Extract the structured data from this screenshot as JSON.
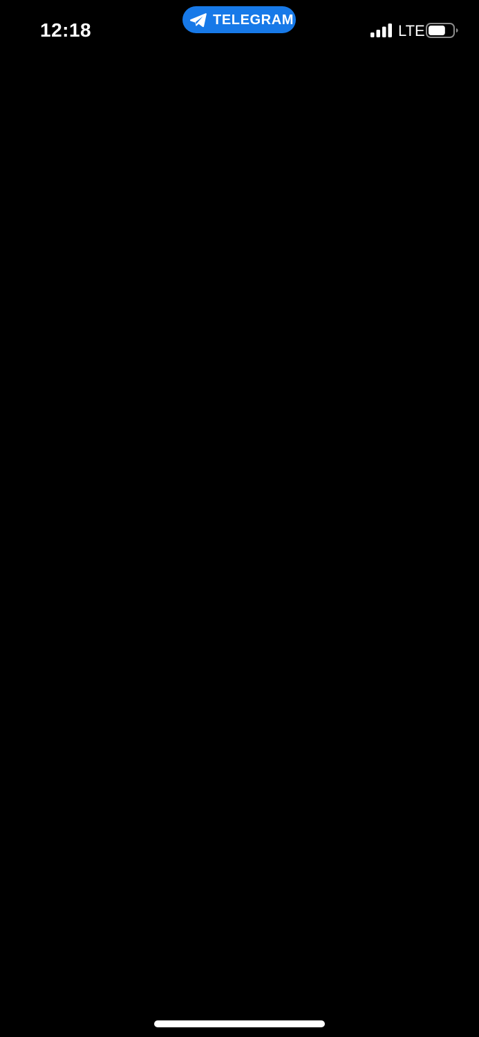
{
  "status_bar": {
    "time": "12:18",
    "network": "LTE",
    "signal_bars": 4,
    "battery_level": 0.7
  },
  "active_app_pill": {
    "label": "TELEGRAM",
    "icon": "telegram-paper-plane-icon",
    "color": "#1779e8"
  },
  "screen": {
    "background": "#000000",
    "content": ""
  }
}
